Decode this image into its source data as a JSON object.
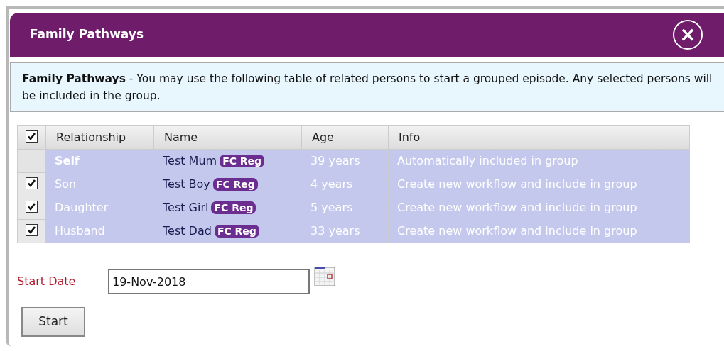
{
  "dialog": {
    "title": "Family Pathways",
    "close": "×"
  },
  "notice": {
    "text": "**Family Pathways** - You may use the following table of related persons to start a grouped episode. Any selected persons will be included in the group."
  },
  "table": {
    "select_all": {
      "checked": true
    },
    "columns": [
      "Relationship",
      "Name",
      "Age",
      "Info"
    ],
    "rows": [
      {
        "kind": "self",
        "relationship": "Self",
        "name": "Test Mum",
        "badge": "FC Reg",
        "age": "39 years",
        "info": "Automatically included in group"
      },
      {
        "kind": "relative",
        "checked": true,
        "relationship": "Son",
        "name": "Test Boy",
        "badge": "FC Reg",
        "age": "4 years",
        "info": "Create new workflow and include in group"
      },
      {
        "kind": "relative",
        "checked": true,
        "relationship": "Daughter",
        "name": "Test Girl",
        "badge": "FC Reg",
        "age": "5 years",
        "info": "Create new workflow and include in group"
      },
      {
        "kind": "relative",
        "checked": true,
        "relationship": "Husband",
        "name": "Test Dad",
        "badge": "FC Reg",
        "age": "33 years",
        "info": "Create new workflow and include in group"
      }
    ]
  },
  "start_date": {
    "label": "Start Date",
    "value": "19-Nov-2018"
  },
  "buttons": [
    "Start"
  ]
}
